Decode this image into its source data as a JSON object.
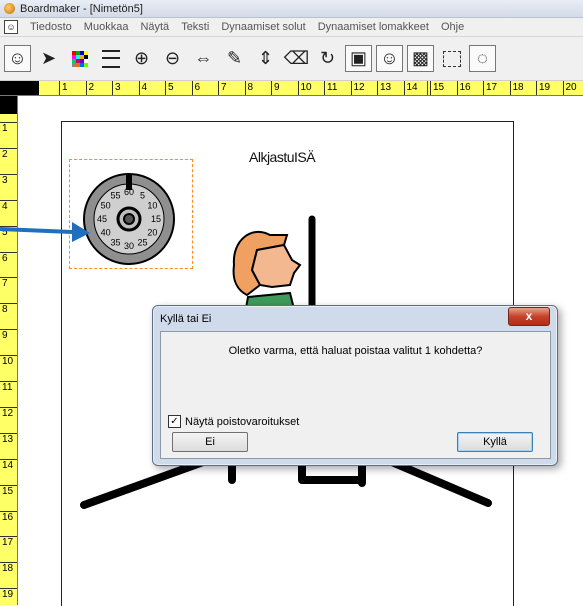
{
  "window": {
    "title": "Boardmaker - [Nimetön5]",
    "icon": "boardmaker-app-icon"
  },
  "menu": [
    "Tiedosto",
    "Muokkaa",
    "Näytä",
    "Teksti",
    "Dynaamiset solut",
    "Dynaamiset lomakkeet",
    "Ohje"
  ],
  "toolbar": {
    "tools": [
      {
        "name": "symbol-finder-icon",
        "glyph": "☺",
        "boxed": true
      },
      {
        "name": "pointer-icon",
        "glyph": "➤",
        "boxed": false
      },
      {
        "name": "color-palette-icon",
        "glyph": "",
        "boxed": false
      },
      {
        "name": "line-thickness-icon",
        "glyph": "",
        "boxed": false
      },
      {
        "name": "zoom-in-icon",
        "glyph": "⊕",
        "boxed": false
      },
      {
        "name": "zoom-out-icon",
        "glyph": "⊖",
        "boxed": false
      },
      {
        "name": "flip-horizontal-icon",
        "glyph": "⇔",
        "boxed": false
      },
      {
        "name": "pencil-icon",
        "glyph": "✎",
        "boxed": false
      },
      {
        "name": "spacing-icon",
        "glyph": "⇕",
        "boxed": false
      },
      {
        "name": "eraser-icon",
        "glyph": "⌫",
        "boxed": false
      },
      {
        "name": "rotate-icon",
        "glyph": "↻",
        "boxed": false
      },
      {
        "name": "button-tool-icon",
        "glyph": "▣",
        "boxed": true
      },
      {
        "name": "symbol-button-icon",
        "glyph": "☺",
        "boxed": true
      },
      {
        "name": "freeform-button-icon",
        "glyph": "▩",
        "boxed": true
      },
      {
        "name": "selection-rectangle-icon",
        "glyph": "",
        "boxed": false
      },
      {
        "name": "freeform-shape-icon",
        "glyph": "◌",
        "boxed": true
      }
    ]
  },
  "ruler": {
    "horizontal": [
      "1",
      "2",
      "3",
      "4",
      "5",
      "6",
      "7",
      "8",
      "9",
      "10",
      "11",
      "12",
      "13",
      "14",
      "15",
      "16",
      "17",
      "18",
      "19",
      "20"
    ],
    "vertical": [
      "1",
      "2",
      "3",
      "4",
      "5",
      "6",
      "7",
      "8",
      "9",
      "10",
      "11",
      "12",
      "13",
      "14",
      "15",
      "16",
      "17",
      "18",
      "19"
    ]
  },
  "canvas": {
    "title": "AlkjastuISÄ",
    "clock_numbers": [
      "60",
      "5",
      "10",
      "15",
      "20",
      "25",
      "30",
      "35",
      "40",
      "45",
      "50",
      "55"
    ]
  },
  "dialog": {
    "title": "Kyllä tai Ei",
    "close_glyph": "x",
    "message": "Oletko varma, että haluat poistaa valitut 1 kohdetta?",
    "checkbox_label": "Näytä poistovaroitukset",
    "checkbox_checked": true,
    "check_glyph": "✓",
    "no_button": "Ei",
    "yes_button": "Kyllä"
  },
  "colors": {
    "ruler": "#ffff66",
    "selection_border": "#ff8a1e",
    "arrow": "#1f6fbf",
    "dialog_frame": "#cfdaea",
    "close_button": "#c5432a",
    "figure_hair": "#f0a060",
    "figure_shirt": "#3e9a5a"
  }
}
